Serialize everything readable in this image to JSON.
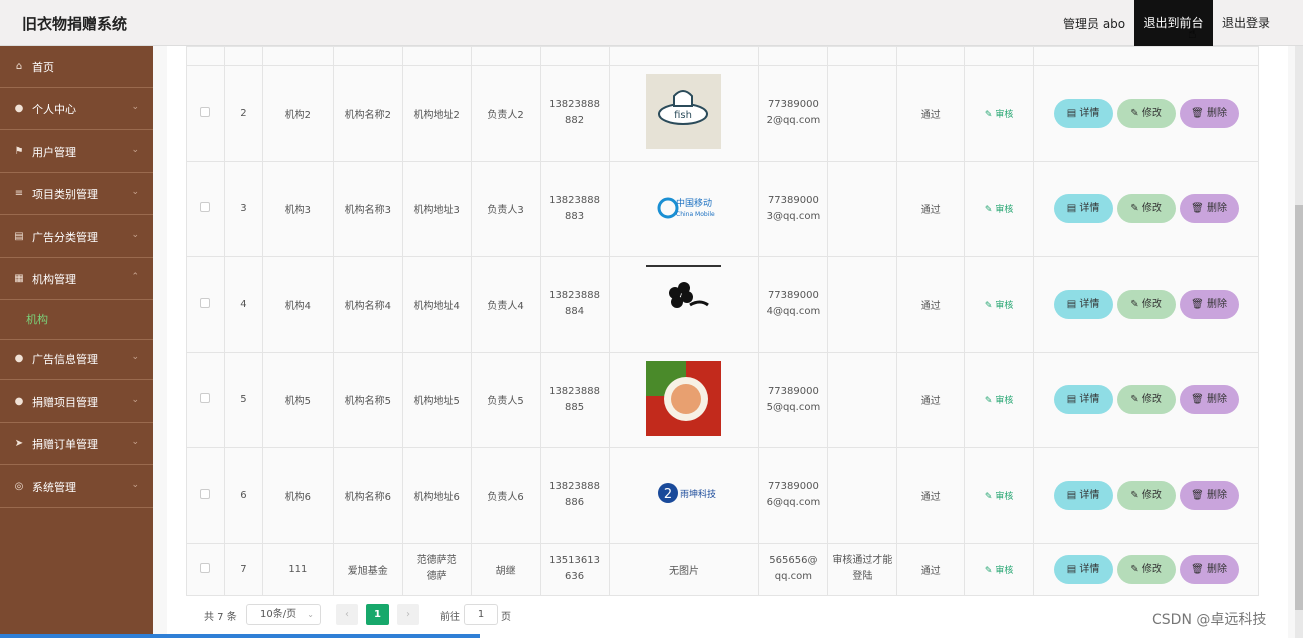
{
  "header": {
    "title": "旧衣物捐赠系统",
    "admin": "管理员 abo",
    "front_button": "退出到前台",
    "logout_button": "退出登录"
  },
  "sidebar": {
    "items": [
      {
        "icon": "home-icon",
        "label": "首页"
      },
      {
        "icon": "user-icon",
        "label": "个人中心"
      },
      {
        "icon": "flag-icon",
        "label": "用户管理"
      },
      {
        "icon": "list-icon",
        "label": "项目类别管理"
      },
      {
        "icon": "clipboard-icon",
        "label": "广告分类管理"
      },
      {
        "icon": "building-icon",
        "label": "机构管理"
      },
      {
        "icon": "bulb-icon",
        "label": "广告信息管理"
      },
      {
        "icon": "mic-icon",
        "label": "捐赠项目管理"
      },
      {
        "icon": "send-icon",
        "label": "捐赠订单管理"
      },
      {
        "icon": "settings-icon",
        "label": "系统管理"
      }
    ],
    "sub_item": "机构"
  },
  "table": {
    "rows": [
      {
        "index": "2",
        "account": "机构2",
        "name": "机构名称2",
        "address": "机构地址2",
        "manager": "负责人2",
        "phone": "13823888882",
        "image": "fish-logo",
        "email": "773890002@qq.com",
        "note": "",
        "status": "通过"
      },
      {
        "index": "3",
        "account": "机构3",
        "name": "机构名称3",
        "address": "机构地址3",
        "manager": "负责人3",
        "phone": "13823888883",
        "image": "china-mobile-logo",
        "email": "773890003@qq.com",
        "note": "",
        "status": "通过"
      },
      {
        "index": "4",
        "account": "机构4",
        "name": "机构名称4",
        "address": "机构地址4",
        "manager": "负责人4",
        "phone": "13823888884",
        "image": "clover-logo",
        "email": "773890004@qq.com",
        "note": "",
        "status": "通过"
      },
      {
        "index": "5",
        "account": "机构5",
        "name": "机构名称5",
        "address": "机构地址5",
        "manager": "负责人5",
        "phone": "13823888885",
        "image": "red-circle-logo",
        "email": "773890005@qq.com",
        "note": "",
        "status": "通过"
      },
      {
        "index": "6",
        "account": "机构6",
        "name": "机构名称6",
        "address": "机构地址6",
        "manager": "负责人6",
        "phone": "13823888886",
        "image": "tech-logo",
        "email": "773890006@qq.com",
        "note": "",
        "status": "通过"
      },
      {
        "index": "7",
        "account": "111",
        "name": "爱旭基金",
        "address": "范德萨范德萨",
        "manager": "胡继",
        "phone": "13513613636",
        "image": "",
        "email": "565656@qq.com",
        "note": "审核通过才能登陆",
        "status": "通过"
      }
    ],
    "no_image_text": "无图片",
    "logo_text": {
      "china_mobile": "中国移动",
      "china_mobile_en": "China Mobile",
      "tech": "雨坤科技",
      "fish": "fish"
    },
    "audit_label": "审核",
    "detail_label": "详情",
    "edit_label": "修改",
    "delete_label": "删除"
  },
  "pagination": {
    "total": "共 7 条",
    "page_size": "10条/页",
    "current": "1",
    "goto_label": "前往",
    "goto_value": "1",
    "page_suffix": "页"
  },
  "watermark": "CSDN @卓远科技"
}
